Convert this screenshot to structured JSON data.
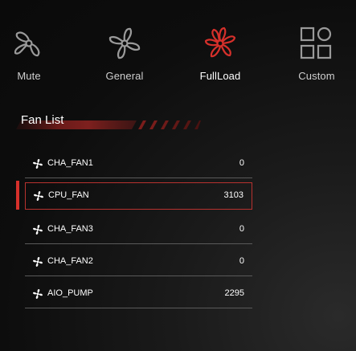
{
  "modes": [
    {
      "label": "Mute",
      "icon": "fan-mute-icon",
      "active": false
    },
    {
      "label": "General",
      "icon": "fan-general-icon",
      "active": false
    },
    {
      "label": "FullLoad",
      "icon": "fan-fullload-icon",
      "active": true
    },
    {
      "label": "Custom",
      "icon": "custom-grid-icon",
      "active": false
    }
  ],
  "fan_list": {
    "title": "Fan List",
    "selected_index": 1,
    "items": [
      {
        "name": "CHA_FAN1",
        "rpm": "0"
      },
      {
        "name": "CPU_FAN",
        "rpm": "3103"
      },
      {
        "name": "CHA_FAN3",
        "rpm": "0"
      },
      {
        "name": "CHA_FAN2",
        "rpm": "0"
      },
      {
        "name": "AIO_PUMP",
        "rpm": "2295"
      }
    ]
  },
  "colors": {
    "accent": "#d6302b",
    "icon_inactive": "#9a9a9a",
    "text": "#ffffff",
    "divider": "#5a5a5a"
  }
}
